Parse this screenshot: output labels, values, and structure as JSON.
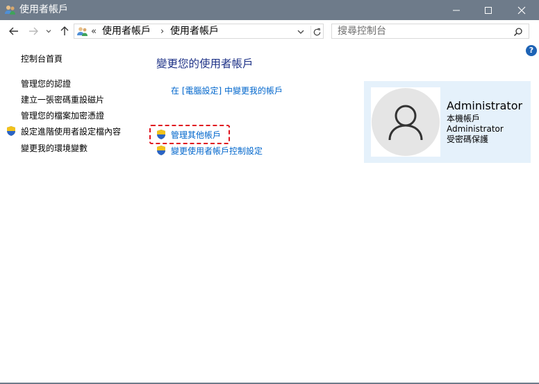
{
  "window": {
    "title": "使用者帳戶",
    "titlebar_color": "#6e7b8a"
  },
  "address_bar": {
    "prefix": "«",
    "segments": [
      "使用者帳戶",
      "使用者帳戶"
    ],
    "separator": "›"
  },
  "search": {
    "placeholder": "搜尋控制台"
  },
  "icons": [
    "users-icon",
    "back-arrow-icon",
    "forward-arrow-icon",
    "recent-dropdown-icon",
    "up-arrow-icon",
    "refresh-icon",
    "search-icon",
    "help-icon",
    "uac-shield-icon",
    "user-silhouette-icon",
    "minimize-icon",
    "maximize-icon",
    "close-icon"
  ],
  "help": {
    "label": "?"
  },
  "left_nav": {
    "items": [
      {
        "label": "控制台首頁"
      },
      {
        "label": "管理您的認證"
      },
      {
        "label": "建立一張密碼重設磁片"
      },
      {
        "label": "管理您的檔案加密憑證"
      },
      {
        "label": "設定進階使用者設定檔內容"
      },
      {
        "label": "變更我的環境變數"
      }
    ]
  },
  "main": {
    "heading": "變更您的使用者帳戶",
    "pc_settings_link": "在 [電腦設定] 中變更我的帳戶",
    "manage_other_link": "管理其他帳戶",
    "uac_settings_link": "變更使用者帳戶控制設定"
  },
  "account": {
    "name": "Administrator",
    "type": "本機帳戶",
    "group": "Administrator",
    "protection": "受密碼保護"
  },
  "colors": {
    "link": "#0066cc",
    "heading": "#1e3287",
    "highlight": "#e0141e",
    "card_bg": "#e5f1fb"
  }
}
